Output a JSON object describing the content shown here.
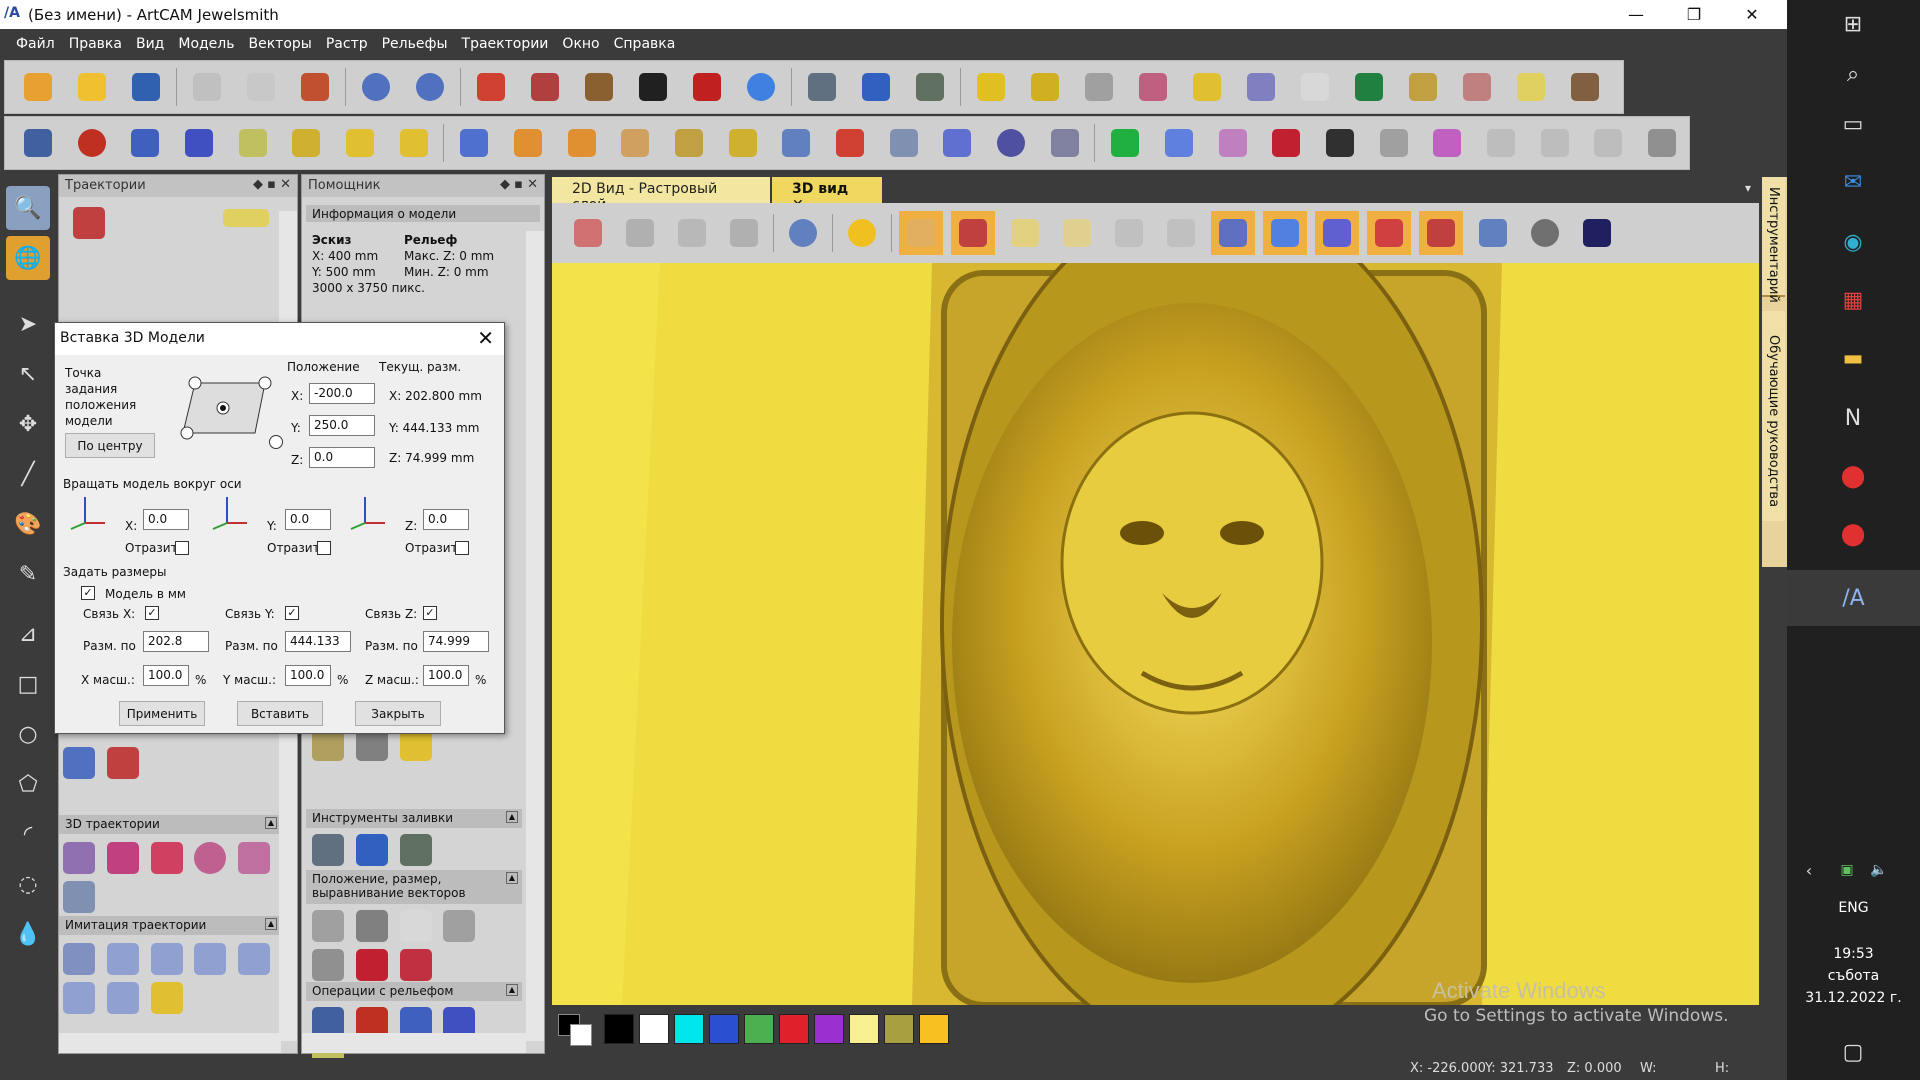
{
  "window": {
    "title": "(Без имени) - ArtCAM Jewelsmith",
    "app_icon": "artcam-icon"
  },
  "menu": [
    "Файл",
    "Правка",
    "Вид",
    "Модель",
    "Векторы",
    "Растр",
    "Рельефы",
    "Траектории",
    "Окно",
    "Справка"
  ],
  "panels": {
    "trajectories": {
      "title": "Траектории",
      "sections": [
        "3D траектории",
        "Имитация траектории"
      ]
    },
    "assistant": {
      "title": "Помощник",
      "model_info": {
        "header": "Информация о модели",
        "col1": "Эскиз",
        "col2": "Рельеф",
        "x": "X: 400 mm",
        "y": "Y: 500 mm",
        "max_z": "Макс. Z: 0 mm",
        "min_z": "Мин. Z: 0 mm",
        "pixels": "3000 x 3750 пикс."
      },
      "sections": [
        "Инструменты заливки",
        "Положение, размер, выравнивание векторов",
        "Операции с рельефом"
      ]
    }
  },
  "tabs": [
    "2D Вид - Растровый слой",
    "3D вид"
  ],
  "dialog": {
    "title": "Вставка 3D Модели",
    "anchor_label": "Точка задания положения модели",
    "center_button": "По центру",
    "position_header": "Положение",
    "cur_size_header": "Текущ. разм.",
    "pos": {
      "x_label": "X:",
      "x": "-200.0",
      "y_label": "Y:",
      "y": "250.0",
      "z_label": "Z:",
      "z": "0.0"
    },
    "cur": {
      "x": "X: 202.800 mm",
      "y": "Y: 444.133 mm",
      "z": "Z: 74.999 mm"
    },
    "rotate_label": "Вращать модель вокруг оси",
    "rot": {
      "x_label": "X:",
      "x": "0.0",
      "y_label": "Y:",
      "y": "0.0",
      "z_label": "Z:",
      "z": "0.0"
    },
    "mirror_label": "Отразит",
    "size_label": "Задать размеры",
    "model_mm_label": "Модель в мм",
    "link_x": "Связь X:",
    "link_y": "Связь Y:",
    "link_z": "Связь Z:",
    "size_by": "Разм. по",
    "size": {
      "x": "202.8",
      "y": "444.133",
      "z": "74.999"
    },
    "scale_x_label": "X масш.:",
    "scale_y_label": "Y масш.:",
    "scale_z_label": "Z масш.:",
    "scale": {
      "x": "100.0",
      "y": "100.0",
      "z": "100.0"
    },
    "percent": "%",
    "apply_button": "Применить",
    "insert_button": "Вставить",
    "close_button": "Закрыть"
  },
  "right_dock": {
    "tools": "Инструментарий",
    "tutorials": "Обучающие руководства"
  },
  "palette": [
    "#000000",
    "#ffffff",
    "#00e5ee",
    "#2a4fd0",
    "#4cb050",
    "#e0202a",
    "#9a30d0",
    "#f8f090",
    "#a8a040",
    "#f8c020"
  ],
  "watermark": {
    "line1": "Activate Windows",
    "line2": "Go to Settings to activate Windows."
  },
  "status": {
    "x": "X: -226.000",
    "y": "Y: 321.733",
    "z": "Z: 0.000",
    "w": "W:",
    "h": "H:"
  },
  "taskbar": {
    "lang": "ENG",
    "time": "19:53",
    "day": "събота",
    "date": "31.12.2022 г."
  }
}
